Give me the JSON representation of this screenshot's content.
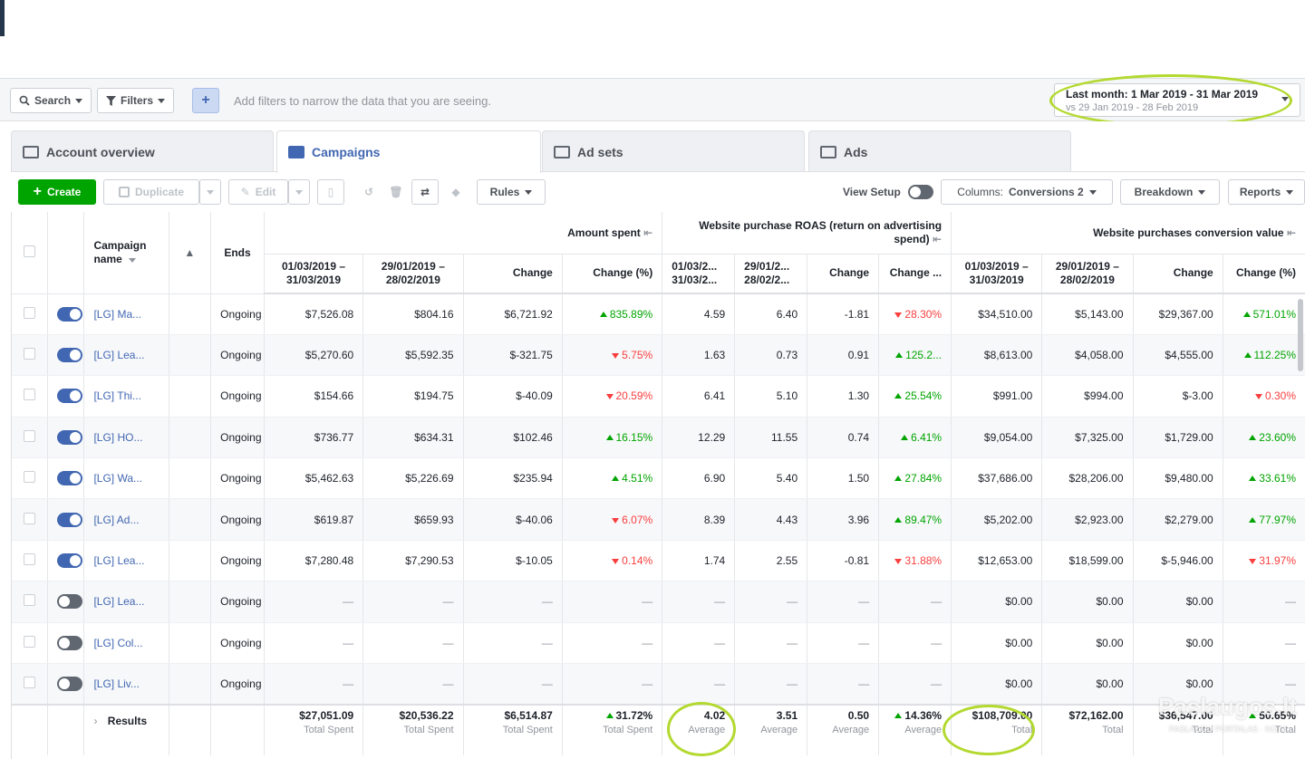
{
  "filter_bar": {
    "search_label": "Search",
    "filters_label": "Filters",
    "add_label": "+",
    "hint": "Add filters to narrow the data that you are seeing.",
    "date_main": "Last month: 1 Mar 2019 - 31 Mar 2019",
    "date_compare": "vs 29 Jan 2019 - 28 Feb 2019"
  },
  "tabs": [
    {
      "label": "Account overview",
      "icon": "account-overview-icon"
    },
    {
      "label": "Campaigns",
      "icon": "campaigns-icon"
    },
    {
      "label": "Ad sets",
      "icon": "ad-sets-icon"
    },
    {
      "label": "Ads",
      "icon": "ads-icon"
    }
  ],
  "toolbar": {
    "create": "Create",
    "duplicate": "Duplicate",
    "edit": "Edit",
    "rules": "Rules",
    "view_setup": "View Setup",
    "columns_prefix": "Columns:",
    "columns_value": "Conversions 2",
    "breakdown": "Breakdown",
    "reports": "Reports"
  },
  "table": {
    "headers": {
      "campaign_name": "Campaign name",
      "ends": "Ends",
      "amount_spent": "Amount spent",
      "roas": "Website purchase ROAS (return on advertising spend)",
      "conv_value": "Website purchases conversion value"
    },
    "sub_headers": {
      "amount": [
        "01/03/2019 – 31/03/2019",
        "29/01/2019 – 28/02/2019",
        "Change",
        "Change (%)"
      ],
      "roas": [
        "01/03/2... 31/03/2...",
        "29/01/2... 28/02/2...",
        "Change",
        "Change ..."
      ],
      "conv": [
        "01/03/2019 – 31/03/2019",
        "29/01/2019 – 28/02/2019",
        "Change",
        "Change (%)"
      ]
    },
    "rows": [
      {
        "on": true,
        "name": "[LG] Ma...",
        "ends": "Ongoing",
        "a1": "$7,526.08",
        "a2": "$804.16",
        "a3": "$6,721.92",
        "a4": "835.89%",
        "a4d": "up",
        "r1": "4.59",
        "r2": "6.40",
        "r3": "-1.81",
        "r4": "28.30%",
        "r4d": "down",
        "c1": "$34,510.00",
        "c2": "$5,143.00",
        "c3": "$29,367.00",
        "c4": "571.01%",
        "c4d": "up"
      },
      {
        "on": true,
        "name": "[LG] Lea...",
        "ends": "Ongoing",
        "a1": "$5,270.60",
        "a2": "$5,592.35",
        "a3": "$-321.75",
        "a4": "5.75%",
        "a4d": "down",
        "r1": "1.63",
        "r2": "0.73",
        "r3": "0.91",
        "r4": "125.2...",
        "r4d": "up",
        "c1": "$8,613.00",
        "c2": "$4,058.00",
        "c3": "$4,555.00",
        "c4": "112.25%",
        "c4d": "up"
      },
      {
        "on": true,
        "name": "[LG] Thi...",
        "ends": "Ongoing",
        "a1": "$154.66",
        "a2": "$194.75",
        "a3": "$-40.09",
        "a4": "20.59%",
        "a4d": "down",
        "r1": "6.41",
        "r2": "5.10",
        "r3": "1.30",
        "r4": "25.54%",
        "r4d": "up",
        "c1": "$991.00",
        "c2": "$994.00",
        "c3": "$-3.00",
        "c4": "0.30%",
        "c4d": "down"
      },
      {
        "on": true,
        "name": "[LG] HO...",
        "ends": "Ongoing",
        "a1": "$736.77",
        "a2": "$634.31",
        "a3": "$102.46",
        "a4": "16.15%",
        "a4d": "up",
        "r1": "12.29",
        "r2": "11.55",
        "r3": "0.74",
        "r4": "6.41%",
        "r4d": "up",
        "c1": "$9,054.00",
        "c2": "$7,325.00",
        "c3": "$1,729.00",
        "c4": "23.60%",
        "c4d": "up"
      },
      {
        "on": true,
        "name": "[LG] Wa...",
        "ends": "Ongoing",
        "a1": "$5,462.63",
        "a2": "$5,226.69",
        "a3": "$235.94",
        "a4": "4.51%",
        "a4d": "up",
        "r1": "6.90",
        "r2": "5.40",
        "r3": "1.50",
        "r4": "27.84%",
        "r4d": "up",
        "c1": "$37,686.00",
        "c2": "$28,206.00",
        "c3": "$9,480.00",
        "c4": "33.61%",
        "c4d": "up"
      },
      {
        "on": true,
        "name": "[LG] Ad...",
        "ends": "Ongoing",
        "a1": "$619.87",
        "a2": "$659.93",
        "a3": "$-40.06",
        "a4": "6.07%",
        "a4d": "down",
        "r1": "8.39",
        "r2": "4.43",
        "r3": "3.96",
        "r4": "89.47%",
        "r4d": "up",
        "c1": "$5,202.00",
        "c2": "$2,923.00",
        "c3": "$2,279.00",
        "c4": "77.97%",
        "c4d": "up"
      },
      {
        "on": true,
        "name": "[LG] Lea...",
        "ends": "Ongoing",
        "a1": "$7,280.48",
        "a2": "$7,290.53",
        "a3": "$-10.05",
        "a4": "0.14%",
        "a4d": "down",
        "r1": "1.74",
        "r2": "2.55",
        "r3": "-0.81",
        "r4": "31.88%",
        "r4d": "down",
        "c1": "$12,653.00",
        "c2": "$18,599.00",
        "c3": "$-5,946.00",
        "c4": "31.97%",
        "c4d": "down"
      },
      {
        "on": false,
        "name": "[LG] Lea...",
        "ends": "Ongoing",
        "a1": "—",
        "a2": "—",
        "a3": "—",
        "a4": "—",
        "a4d": "",
        "r1": "—",
        "r2": "—",
        "r3": "—",
        "r4": "—",
        "r4d": "",
        "c1": "$0.00",
        "c2": "$0.00",
        "c3": "$0.00",
        "c4": "—",
        "c4d": ""
      },
      {
        "on": false,
        "name": "[LG] Col...",
        "ends": "Ongoing",
        "a1": "—",
        "a2": "—",
        "a3": "—",
        "a4": "—",
        "a4d": "",
        "r1": "—",
        "r2": "—",
        "r3": "—",
        "r4": "—",
        "r4d": "",
        "c1": "$0.00",
        "c2": "$0.00",
        "c3": "$0.00",
        "c4": "—",
        "c4d": ""
      },
      {
        "on": false,
        "name": "[LG] Liv...",
        "ends": "Ongoing",
        "a1": "—",
        "a2": "—",
        "a3": "—",
        "a4": "—",
        "a4d": "",
        "r1": "—",
        "r2": "—",
        "r3": "—",
        "r4": "—",
        "r4d": "",
        "c1": "$0.00",
        "c2": "$0.00",
        "c3": "$0.00",
        "c4": "—",
        "c4d": ""
      }
    ],
    "results": {
      "label": "Results",
      "cells": [
        {
          "v": "$27,051.09",
          "s": "Total Spent",
          "d": ""
        },
        {
          "v": "$20,536.22",
          "s": "Total Spent",
          "d": ""
        },
        {
          "v": "$6,514.87",
          "s": "Total Spent",
          "d": ""
        },
        {
          "v": "31.72%",
          "s": "Total Spent",
          "d": "up"
        },
        {
          "v": "4.02",
          "s": "Average",
          "d": ""
        },
        {
          "v": "3.51",
          "s": "Average",
          "d": ""
        },
        {
          "v": "0.50",
          "s": "Average",
          "d": ""
        },
        {
          "v": "14.36%",
          "s": "Average",
          "d": "up"
        },
        {
          "v": "$108,709.00",
          "s": "Total",
          "d": ""
        },
        {
          "v": "$72,162.00",
          "s": "Total",
          "d": ""
        },
        {
          "v": "$36,547.00",
          "s": "Total",
          "d": ""
        },
        {
          "v": "50.65%",
          "s": "Total",
          "d": "up"
        }
      ]
    }
  },
  "watermark": {
    "title": "Paslaugos.lt",
    "subtitle": "PASLAUGŲ PORTALAS · NO. 1"
  },
  "colors": {
    "accent": "#4267b2",
    "create": "#00a400",
    "up": "#00a400",
    "down": "#fa3e3e",
    "highlight": "#b3d930"
  }
}
